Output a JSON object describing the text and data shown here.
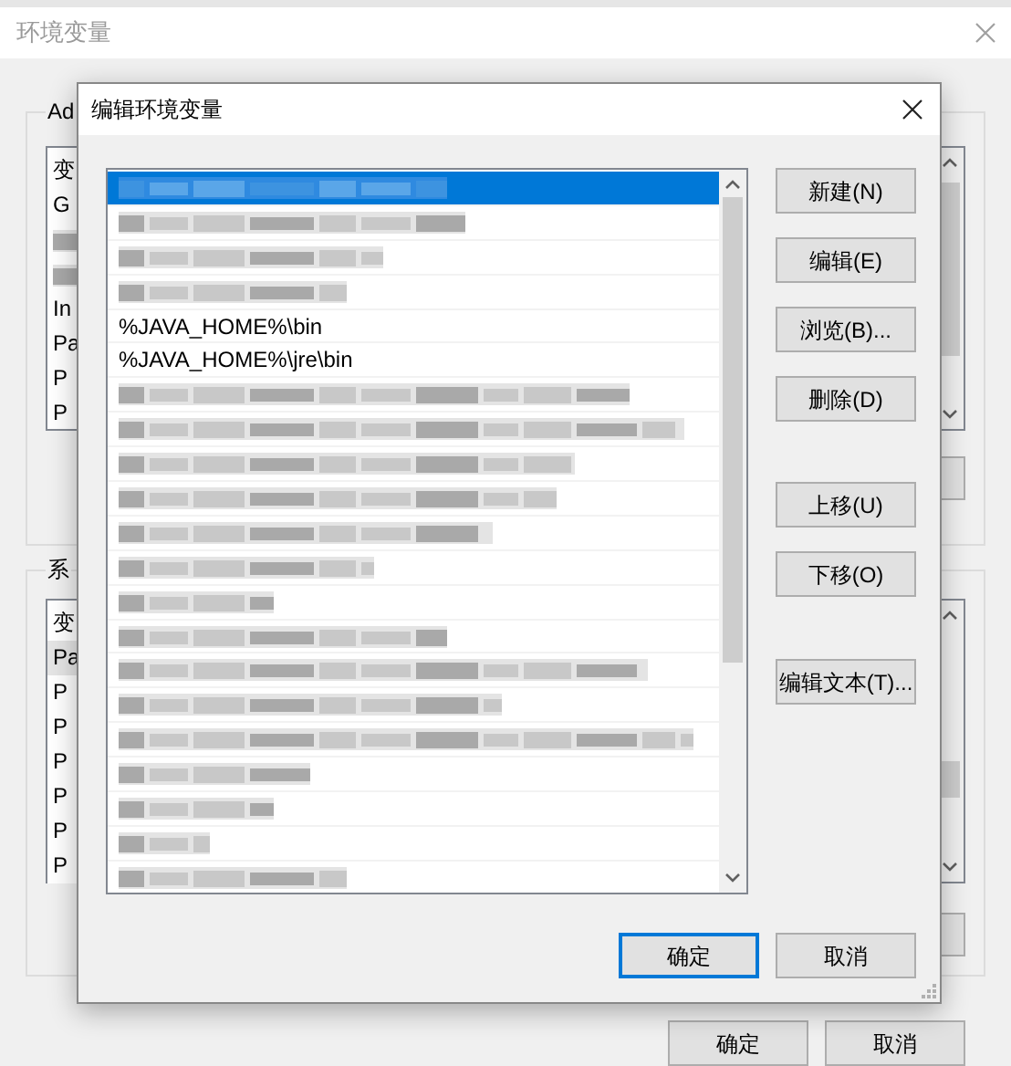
{
  "window": {
    "title": "环境变量"
  },
  "user_vars": {
    "label": "Ad",
    "header": "变",
    "rows": [
      {
        "kind": "text",
        "name": "G"
      },
      {
        "kind": "redacted"
      },
      {
        "kind": "redacted"
      },
      {
        "kind": "text",
        "name": "In"
      },
      {
        "kind": "text",
        "name": "Pa"
      },
      {
        "kind": "text",
        "name": "P"
      },
      {
        "kind": "text",
        "name": "P"
      }
    ]
  },
  "system_vars": {
    "label": "系",
    "header": "变",
    "rows": [
      {
        "name": "Pa",
        "selected": true
      },
      {
        "name": "P",
        "selected": false
      },
      {
        "name": "P",
        "selected": false
      },
      {
        "name": "P",
        "selected": false
      },
      {
        "name": "P",
        "selected": false
      },
      {
        "name": "P",
        "selected": false
      },
      {
        "name": "P",
        "selected": false
      }
    ]
  },
  "buttons": [
    {
      "label": "确定"
    },
    {
      "label": "取消"
    }
  ],
  "dialog": {
    "title": "编辑环境变量",
    "entries": [
      {
        "kind": "redacted",
        "selected": true
      },
      {
        "kind": "redacted",
        "selected": false
      },
      {
        "kind": "redacted",
        "selected": false
      },
      {
        "kind": "redacted",
        "selected": false
      },
      {
        "kind": "text",
        "text": "%JAVA_HOME%\\bin",
        "selected": false
      },
      {
        "kind": "text",
        "text": "%JAVA_HOME%\\jre\\bin",
        "selected": false
      },
      {
        "kind": "redacted",
        "selected": false
      },
      {
        "kind": "redacted",
        "selected": false
      },
      {
        "kind": "redacted",
        "selected": false
      },
      {
        "kind": "redacted",
        "selected": false
      },
      {
        "kind": "redacted",
        "selected": false
      },
      {
        "kind": "redacted",
        "selected": false
      },
      {
        "kind": "redacted",
        "selected": false
      },
      {
        "kind": "redacted",
        "selected": false
      },
      {
        "kind": "redacted",
        "selected": false
      },
      {
        "kind": "redacted",
        "selected": false
      },
      {
        "kind": "redacted",
        "selected": false
      },
      {
        "kind": "redacted",
        "selected": false
      },
      {
        "kind": "redacted",
        "selected": false
      },
      {
        "kind": "redacted",
        "selected": false
      },
      {
        "kind": "redacted",
        "selected": false
      }
    ],
    "side_buttons": [
      {
        "label": "新建(N)"
      },
      {
        "label": "编辑(E)"
      },
      {
        "label": "浏览(B)..."
      },
      {
        "label": "删除(D)"
      },
      {
        "label": "上移(U)"
      },
      {
        "label": "下移(O)"
      },
      {
        "label": "编辑文本(T)..."
      }
    ],
    "footer_buttons": [
      {
        "label": "确定",
        "default": true
      },
      {
        "label": "取消",
        "default": false
      }
    ]
  }
}
